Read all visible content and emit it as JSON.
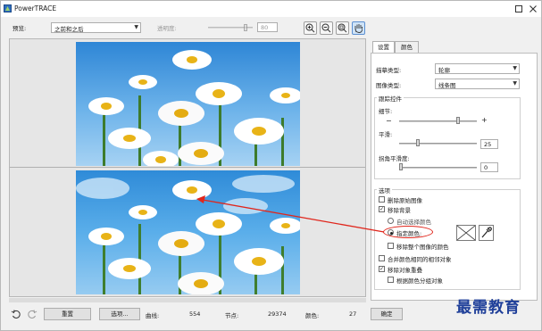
{
  "window": {
    "title": "PowerTRACE"
  },
  "toolbar": {
    "preview_label": "预览:",
    "preview_value": "之前和之后",
    "transparency_label": "透明度:",
    "transparency_value": "80"
  },
  "tabs": [
    {
      "label": "设置"
    },
    {
      "label": "颜色"
    }
  ],
  "settings": {
    "trace_type_label": "描摹类型:",
    "trace_type_value": "轮廓",
    "image_type_label": "图像类型:",
    "image_type_value": "线条图",
    "trace_controls_title": "跟踪控件",
    "detail_label": "细节:",
    "smoothing_label": "平滑:",
    "smoothing_value": "25",
    "corner_smoothness_label": "拐角平滑度:",
    "corner_smoothness_value": "0",
    "options_title": "选项",
    "delete_original": "删除原始图像",
    "remove_background": "移除背景",
    "auto_select_color": "自动选择颜色",
    "specify_color": "指定颜色:",
    "remove_whole_image_color": "移除整个图像的颜色",
    "merge_adjacent": "合并颜色相同的相邻对象",
    "remove_overlap": "移除对象重叠",
    "group_by_color": "根据颜色分组对象"
  },
  "status": {
    "reset_label": "重置",
    "options_label": "选项...",
    "curves_label": "曲线:",
    "curves_value": "554",
    "nodes_label": "节点:",
    "nodes_value": "29374",
    "colors_label": "颜色:",
    "colors_value": "27",
    "ok_label": "确定"
  },
  "watermark": "最需教育",
  "colors": {
    "accent_red": "#e0261c",
    "sky": "#4a9fe0"
  }
}
